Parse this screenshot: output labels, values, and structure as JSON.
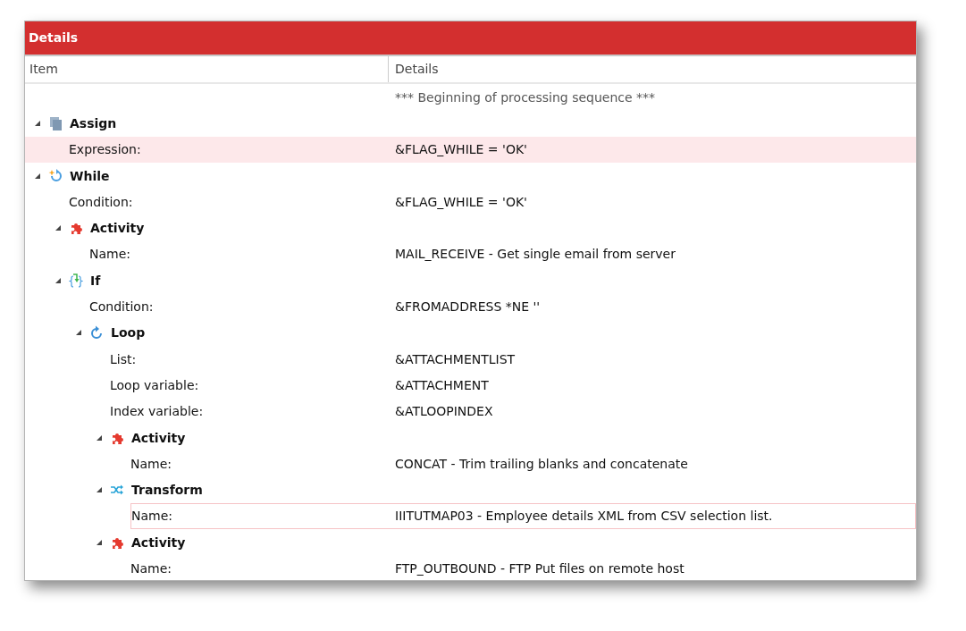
{
  "panel": {
    "title": "Details"
  },
  "table": {
    "columns": [
      "Item",
      "Details"
    ],
    "intro": "*** Beginning of processing sequence ***",
    "tree": [
      {
        "kind": "assign",
        "label": "Assign",
        "expanded": true,
        "properties": [
          {
            "label": "Expression:",
            "value": "&FLAG_WHILE = 'OK'",
            "selected": true,
            "focused": false
          }
        ]
      },
      {
        "kind": "while",
        "label": "While",
        "expanded": true,
        "properties": [
          {
            "label": "Condition:",
            "value": "&FLAG_WHILE = 'OK'",
            "selected": false,
            "focused": false
          }
        ],
        "children": [
          {
            "kind": "activity",
            "label": "Activity",
            "expanded": true,
            "properties": [
              {
                "label": "Name:",
                "value": "MAIL_RECEIVE - Get single email from server",
                "selected": false,
                "focused": false
              }
            ]
          },
          {
            "kind": "if",
            "label": "If",
            "expanded": true,
            "properties": [
              {
                "label": "Condition:",
                "value": "&FROMADDRESS *NE ''",
                "selected": false,
                "focused": false
              }
            ],
            "children": [
              {
                "kind": "loop",
                "label": "Loop",
                "expanded": true,
                "properties": [
                  {
                    "label": "List:",
                    "value": "&ATTACHMENTLIST",
                    "selected": false,
                    "focused": false
                  },
                  {
                    "label": "Loop variable:",
                    "value": "&ATTACHMENT",
                    "selected": false,
                    "focused": false
                  },
                  {
                    "label": "Index variable:",
                    "value": "&ATLOOPINDEX",
                    "selected": false,
                    "focused": false
                  }
                ],
                "children": [
                  {
                    "kind": "activity",
                    "label": "Activity",
                    "expanded": true,
                    "properties": [
                      {
                        "label": "Name:",
                        "value": "CONCAT - Trim trailing blanks and concatenate",
                        "selected": false,
                        "focused": false
                      }
                    ]
                  },
                  {
                    "kind": "transform",
                    "label": "Transform",
                    "expanded": true,
                    "properties": [
                      {
                        "label": "Name:",
                        "value": "IIITUTMAP03 - Employee details XML from CSV selection list.",
                        "selected": false,
                        "focused": true
                      }
                    ]
                  },
                  {
                    "kind": "activity",
                    "label": "Activity",
                    "expanded": true,
                    "properties": [
                      {
                        "label": "Name:",
                        "value": "FTP_OUTBOUND - FTP Put files on remote host",
                        "selected": false,
                        "focused": false
                      }
                    ]
                  }
                ]
              }
            ]
          }
        ]
      }
    ]
  }
}
